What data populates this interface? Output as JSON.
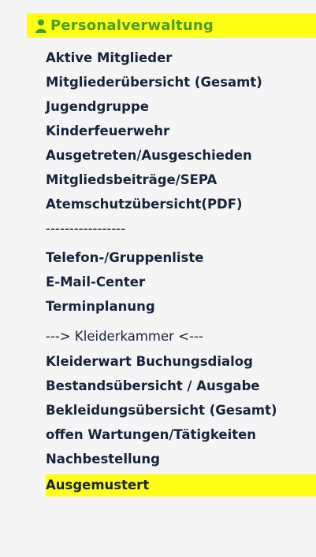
{
  "colors": {
    "highlight": "#ffff14",
    "header_text": "#4a9e2d",
    "item_text": "#17233b",
    "panel_bg": "#f5f5f5"
  },
  "header": {
    "icon": "user-icon",
    "title": "Personalverwaltung"
  },
  "menu": {
    "items": [
      {
        "label": "Aktive Mitglieder",
        "type": "link"
      },
      {
        "label": "Mitgliederübersicht (Gesamt)",
        "type": "link"
      },
      {
        "label": "Jugendgruppe",
        "type": "link"
      },
      {
        "label": "Kinderfeuerwehr",
        "type": "link"
      },
      {
        "label": "Ausgetreten/Ausgeschieden",
        "type": "link"
      },
      {
        "label": "Mitgliedsbeiträge/SEPA",
        "type": "link"
      },
      {
        "label": "Atemschutzübersicht(PDF)",
        "type": "link"
      },
      {
        "label": "-----------------",
        "type": "separator"
      },
      {
        "label": "Telefon-/Gruppenliste",
        "type": "link"
      },
      {
        "label": "E-Mail-Center",
        "type": "link"
      },
      {
        "label": "Terminplanung",
        "type": "link"
      },
      {
        "label": "---> Kleiderkammer <---",
        "type": "heading"
      },
      {
        "label": "Kleiderwart Buchungsdialog",
        "type": "link"
      },
      {
        "label": "Bestandsübersicht / Ausgabe",
        "type": "link"
      },
      {
        "label": "Bekleidungsübersicht (Gesamt)",
        "type": "link"
      },
      {
        "label": "offen Wartungen/Tätigkeiten",
        "type": "link"
      },
      {
        "label": "Nachbestellung",
        "type": "link"
      },
      {
        "label": "Ausgemustert",
        "type": "link",
        "selected": true
      }
    ]
  }
}
